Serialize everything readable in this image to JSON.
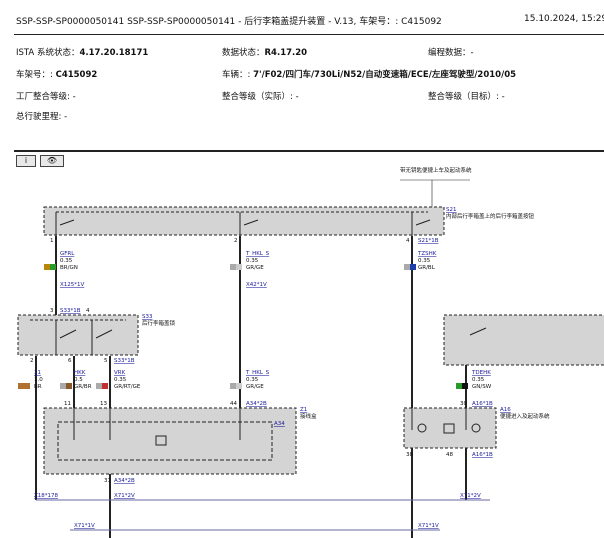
{
  "header": {
    "doc_id": "SSP-SSP-SP0000050141 SSP-SSP-SP0000050141 - 后行李箱盖提升装置 - V.13, 车架号：: C415092",
    "date": "15.10.2024, 15:29:"
  },
  "info": {
    "ista_label": "ISTA 系统状态：",
    "ista_value": "4.17.20.18171",
    "data_label": "数据状态：",
    "data_value": "R4.17.20",
    "prog_label": "编程数据：-",
    "vin_label": "车架号：: ",
    "vin_value": "C415092",
    "vehicle_label": "车辆：: ",
    "vehicle_value": "7'/F02/四门车/730Li/N52/自动变速箱/ECE/左座驾驶型/2010/05",
    "factory_label": "工厂整合等级: -",
    "actual_label": "整合等级（实际）: -",
    "target_label": "整合等级（目标）: -",
    "mileage_label": "总行驶里程: -"
  },
  "toolbar": {
    "info_btn": "i",
    "view_btn": "👁"
  },
  "diagram": {
    "top_note": "带无钥匙便捷上车及起动系统",
    "s21": {
      "id": "S21",
      "desc": "内部后行李箱盖上的后行李箱盖按钮",
      "pins": [
        "1",
        "2",
        "4"
      ],
      "conn_a": "S21*1B"
    },
    "w1": {
      "sig": "GFRL",
      "gauge": "0.35",
      "color": "BR/GN",
      "conn": "X125*1V"
    },
    "w2": {
      "sig": "T_HKL_S",
      "gauge": "0.35",
      "color": "GR/GE",
      "conn": "X42*1V"
    },
    "w3": {
      "sig": "TZSHK",
      "gauge": "0.35",
      "color": "GR/BL"
    },
    "s33": {
      "id": "S33",
      "desc": "后行李箱盖锁",
      "conn_top": "S33*1B",
      "pins_top": [
        "3",
        "4"
      ],
      "pins_bot": [
        "2",
        "6",
        "5"
      ],
      "conn_bot": "S33*1B"
    },
    "w4": {
      "sig": "31",
      "gauge": "1.0",
      "color": "BR"
    },
    "w5": {
      "sig": "HKK",
      "gauge": "0.5",
      "color": "GR/BR"
    },
    "w6": {
      "sig": "VRK",
      "gauge": "0.35",
      "color": "GR/RT/GE"
    },
    "w7": {
      "sig": "T_HKL_S",
      "gauge": "0.35",
      "color": "GR/GE"
    },
    "w8": {
      "sig": "TDEHK",
      "gauge": "0.35",
      "color": "GN/SW"
    },
    "z1": {
      "id": "Z1",
      "desc": "接线盒",
      "conn": "A34",
      "pins": [
        "11",
        "13",
        "44"
      ],
      "conn_b": "A34*2B",
      "conn_c": "A34*2B",
      "pin_31": "31"
    },
    "a16": {
      "id": "A16",
      "desc": "便捷进入及起动系统",
      "pins": [
        "30"
      ],
      "conn": "A16*1B",
      "pins_bot": [
        "38",
        "48"
      ],
      "conn_bot": "A16*1B"
    },
    "conns": {
      "x1": "Z18*178",
      "x2": "X71*2V",
      "x3": "X71*1V",
      "x4": "X71*2V",
      "x5": "X71*1V"
    }
  }
}
